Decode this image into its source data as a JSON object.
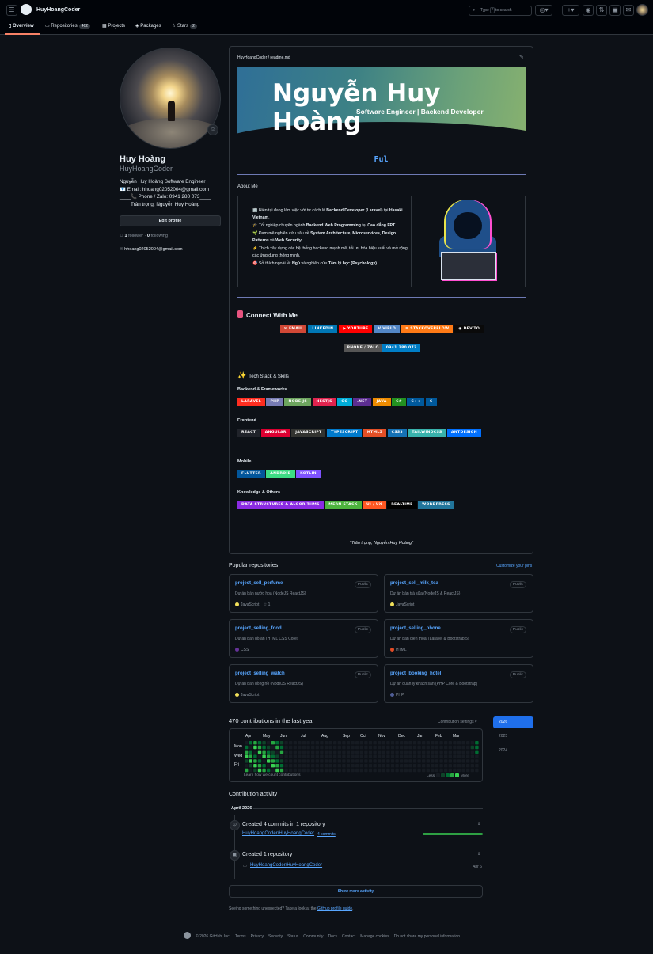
{
  "header": {
    "username": "HuyHoangCoder",
    "search_prefix": "Type",
    "search_key": "/",
    "search_suffix": "to search",
    "add_label": "+"
  },
  "tabs": [
    {
      "label": "Overview"
    },
    {
      "label": "Repositories",
      "count": "462"
    },
    {
      "label": "Projects"
    },
    {
      "label": "Packages"
    },
    {
      "label": "Stars",
      "count": "2"
    }
  ],
  "profile": {
    "name": "Huy Hoàng",
    "login": "HuyHoangCoder",
    "bio_lines": [
      "Nguyễn Huy Hoàng Software Engineer",
      "📧 Email: hhoang02052004@gmail.com",
      "____📞 Phone / Zalo: 0941 280 073____",
      "____Trân trọng, Nguyễn Huy Hoàng ____"
    ],
    "edit_label": "Edit profile",
    "followers": "1",
    "followers_label": "follower",
    "following": "0",
    "following_label": "following",
    "email": "hhoang02052004@gmail.com"
  },
  "readme": {
    "path": "HuyHoangCoder / readme.md",
    "banner_title": "Nguyễn Huy Hoàng",
    "banner_subtitle": "Software Engineer | Backend Developer",
    "typing": "Ful",
    "about_title": "About Me",
    "about_items": [
      {
        "icon": "🏢",
        "pre": "Hiện tại đang làm việc với tư cách là ",
        "b1": "Backend Developer (Laravel)",
        "mid": " tại ",
        "b2": "Hasaki Vietnam",
        "post": "."
      },
      {
        "icon": "🎓",
        "pre": "Tốt nghiệp chuyên ngành ",
        "b1": "Backend Web Programming",
        "mid": " tại ",
        "b2": "Cao đẳng FPT",
        "post": "."
      },
      {
        "icon": "🌱",
        "pre": "Đam mê nghiên cứu sâu về ",
        "b1": "System Architecture, Microservices, Design Patterns",
        "mid": " và ",
        "b2": "Web Security",
        "post": "."
      },
      {
        "icon": "⚡",
        "pre": "Thích xây dựng các hệ thống backend mạnh mẽ, tối ưu hóa hiệu suất và mở rộng các ứng dụng thông minh.",
        "b1": "",
        "mid": "",
        "b2": "",
        "post": ""
      },
      {
        "icon": "🎯",
        "pre": "Sở thích ngoài lề: ",
        "b1": "Ngủ",
        "mid": " và nghiên cứu ",
        "b2": "Tâm lý học (Psychology)",
        "post": "."
      }
    ],
    "connect_title": "Connect With Me",
    "connect_badges": [
      {
        "label": "✉ EMAIL",
        "color": "#d14836"
      },
      {
        "label": "LINKEDIN",
        "color": "#0077b5"
      },
      {
        "label": "▶ YOUTUBE",
        "color": "#ff0000"
      },
      {
        "label": "V VIBLO",
        "color": "#5387c6"
      },
      {
        "label": "≡ STACKOVERFLOW",
        "color": "#fe7a16"
      },
      {
        "label": "◉ DEV.TO",
        "color": "#0a0a0a"
      }
    ],
    "phone_badge": {
      "left": "PHONE / ZALO",
      "right": "0941 280 073"
    },
    "tech_title": "Tech Stack & Skills",
    "groups": [
      {
        "title": "Backend & Frameworks",
        "badges": [
          {
            "label": "LARAVEL",
            "color": "#ff2d20"
          },
          {
            "label": "PHP",
            "color": "#777bb4"
          },
          {
            "label": "NODE.JS",
            "color": "#6da55f"
          },
          {
            "label": "NESTJS",
            "color": "#e0234e"
          },
          {
            "label": "GO",
            "color": "#00add8"
          },
          {
            "label": ".NET",
            "color": "#5c2d91"
          },
          {
            "label": "JAVA",
            "color": "#ed8b00"
          },
          {
            "label": "C#",
            "color": "#239120"
          },
          {
            "label": "C++",
            "color": "#00599c"
          },
          {
            "label": "C",
            "color": "#00599c"
          }
        ]
      },
      {
        "title": "Frontend",
        "badges": [
          {
            "label": "REACT",
            "color": "#20232a"
          },
          {
            "label": "ANGULAR",
            "color": "#dd0031"
          },
          {
            "label": "JAVASCRIPT",
            "color": "#323330"
          },
          {
            "label": "TYPESCRIPT",
            "color": "#007acc"
          },
          {
            "label": "HTML5",
            "color": "#e34f26"
          },
          {
            "label": "CSS3",
            "color": "#1572b6"
          },
          {
            "label": "TAILWINDCSS",
            "color": "#38b2ac"
          },
          {
            "label": "ANTDESIGN",
            "color": "#0170fe"
          }
        ]
      },
      {
        "title": "Mobile",
        "badges": [
          {
            "label": "FLUTTER",
            "color": "#02569b"
          },
          {
            "label": "ANDROID",
            "color": "#3ddc84"
          },
          {
            "label": "KOTLIN",
            "color": "#7f52ff"
          }
        ]
      },
      {
        "title": "Knowledge & Others",
        "badges": [
          {
            "label": "DATA STRUCTURES & ALGORITHMS",
            "color": "#8a2be2"
          },
          {
            "label": "MERN STACK",
            "color": "#4db33d"
          },
          {
            "label": "UI / UX",
            "color": "#ff5722"
          },
          {
            "label": "REALTIME",
            "color": "#000000"
          },
          {
            "label": "WORDPRESS",
            "color": "#21759b"
          }
        ]
      }
    ],
    "signature": "\"Trân trọng, Nguyễn Huy Hoàng\""
  },
  "popular": {
    "title": "Popular repositories",
    "customize": "Customize your pins",
    "repos": [
      {
        "name": "project_sell_perfume",
        "visibility": "Public",
        "desc": "Dự án bán nước hoa (NodeJS ReactJS)",
        "lang": "JavaScript",
        "color": "#f1e05a",
        "stars": "1"
      },
      {
        "name": "project_sell_milk_tea",
        "visibility": "Public",
        "desc": "Dự án bán trà sữa (NodeJS & ReactJS)",
        "lang": "JavaScript",
        "color": "#f1e05a",
        "stars": ""
      },
      {
        "name": "project_selling_food",
        "visibility": "Public",
        "desc": "Dự án bán đồ ăn (HTML CSS Core)",
        "lang": "CSS",
        "color": "#663399",
        "stars": ""
      },
      {
        "name": "project_selling_phone",
        "visibility": "Public",
        "desc": "Dự án bán điện thoại (Laravel & Bootstrap 5)",
        "lang": "HTML",
        "color": "#e34c26",
        "stars": ""
      },
      {
        "name": "project_selling_watch",
        "visibility": "Public",
        "desc": "Dự án bán đồng hồ (NodeJS ReactJS)",
        "lang": "JavaScript",
        "color": "#f1e05a",
        "stars": ""
      },
      {
        "name": "project_booking_hotel",
        "visibility": "Public",
        "desc": "Dự án quản lý khách sạn (PHP Core & Bootstrap)",
        "lang": "PHP",
        "color": "#4f5d95",
        "stars": ""
      }
    ]
  },
  "contributions": {
    "title": "470 contributions in the last year",
    "settings": "Contribution settings ▾",
    "months": [
      "Apr",
      "May",
      "Jun",
      "Jul",
      "Aug",
      "Sep",
      "Oct",
      "Nov",
      "Dec",
      "Jan",
      "Feb",
      "Mar"
    ],
    "days": [
      "Mon",
      "Wed",
      "Fri"
    ],
    "learn": "Learn how we count contributions",
    "less": "Less",
    "more": "More",
    "years": [
      "2026",
      "2025",
      "2024"
    ]
  },
  "activity": {
    "title": "Contribution activity",
    "month": "April 2026",
    "item1": {
      "title": "Created 4 commits in 1 repository",
      "repo": "HuyHoangCoder/HuyHoangCoder",
      "commits": "4 commits"
    },
    "item2": {
      "title": "Created 1 repository",
      "repo": "HuyHoangCoder/HuyHoangCoder",
      "date": "Apr 6"
    },
    "show_more": "Show more activity",
    "unexpected": "Seeing something unexpected? Take a look at the",
    "guide": "GitHub profile guide",
    "guide_end": "."
  },
  "footer": [
    "© 2026 GitHub, Inc.",
    "Terms",
    "Privacy",
    "Security",
    "Status",
    "Community",
    "Docs",
    "Contact",
    "Manage cookies",
    "Do not share my personal information"
  ],
  "colors": {
    "accent": "#58a6ff",
    "bg": "#0d1117",
    "green": "#2ea043"
  }
}
